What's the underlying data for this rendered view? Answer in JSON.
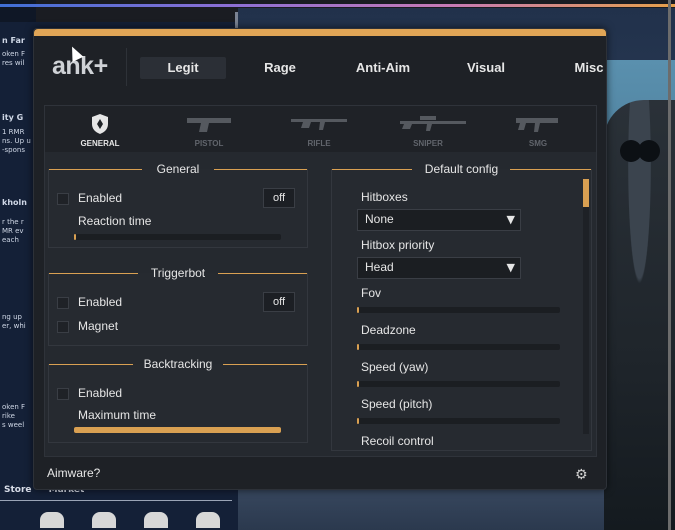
{
  "background": {
    "side_texts": [
      {
        "text": "n Far",
        "bold": true
      },
      {
        "text": "oken F\nres wil"
      },
      {
        "text": "ity G",
        "bold": true
      },
      {
        "text": "1 RMR\nns. Up u\n-spons"
      },
      {
        "text": "kholn",
        "bold": true
      },
      {
        "text": "r the r\nMR ev\neach"
      },
      {
        "text": "ng up\ner, whi"
      },
      {
        "text": "oken F\nrike\ns weel"
      }
    ],
    "bottom_nav": [
      "Store",
      "Market"
    ]
  },
  "menu": {
    "logo": "ank+",
    "tabs": [
      {
        "label": "Legit",
        "active": true
      },
      {
        "label": "Rage",
        "active": false
      },
      {
        "label": "Anti-Aim",
        "active": false
      },
      {
        "label": "Visual",
        "active": false
      },
      {
        "label": "Misc",
        "active": false
      }
    ],
    "weapons": [
      {
        "label": "GENERAL",
        "icon": "shield-icon",
        "active": true
      },
      {
        "label": "PISTOL",
        "icon": "pistol-icon",
        "active": false
      },
      {
        "label": "RIFLE",
        "icon": "rifle-icon",
        "active": false
      },
      {
        "label": "SNIPER",
        "icon": "sniper-icon",
        "active": false
      },
      {
        "label": "SMG",
        "icon": "smg-icon",
        "active": false
      }
    ],
    "general": {
      "title": "General",
      "enabled_label": "Enabled",
      "key_label": "off",
      "reaction_label": "Reaction time",
      "reaction_value": 0.01
    },
    "triggerbot": {
      "title": "Triggerbot",
      "enabled_label": "Enabled",
      "key_label": "off",
      "magnet_label": "Magnet"
    },
    "backtracking": {
      "title": "Backtracking",
      "enabled_label": "Enabled",
      "max_time_label": "Maximum time",
      "max_time_value": 1.0
    },
    "default_config": {
      "title": "Default config",
      "hitboxes_label": "Hitboxes",
      "hitboxes_value": "None",
      "priority_label": "Hitbox priority",
      "priority_value": "Head",
      "fov_label": "Fov",
      "fov_value": 0.01,
      "deadzone_label": "Deadzone",
      "deadzone_value": 0.01,
      "speed_yaw_label": "Speed (yaw)",
      "speed_yaw_value": 0.01,
      "speed_pitch_label": "Speed (pitch)",
      "speed_pitch_value": 0.01,
      "recoil_label": "Recoil control"
    },
    "footer": {
      "text": "Aimware?",
      "settings_icon": "gear-icon"
    },
    "accent_color": "#d9a052"
  }
}
